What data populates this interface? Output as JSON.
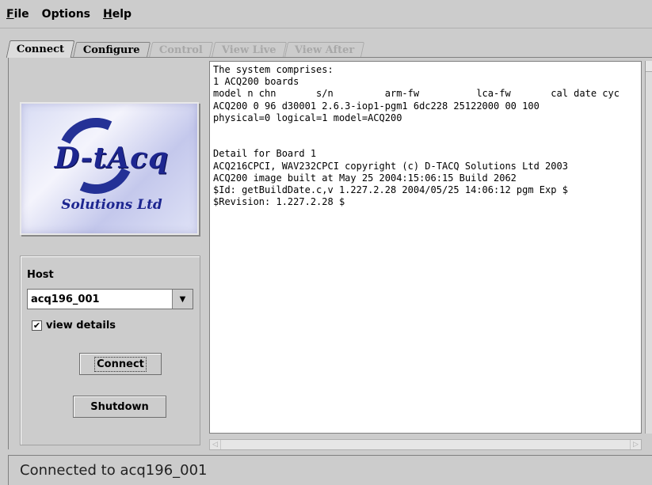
{
  "menu": {
    "file": {
      "mnemonic": "F",
      "rest": "ile"
    },
    "options": {
      "mnemonic": "",
      "rest": "Options"
    },
    "help": {
      "mnemonic": "H",
      "rest": "elp"
    }
  },
  "tabs": [
    {
      "label": "Connect",
      "state": "active"
    },
    {
      "label": "Configure",
      "state": "enabled"
    },
    {
      "label": "Control",
      "state": "disabled"
    },
    {
      "label": "View Live",
      "state": "disabled"
    },
    {
      "label": "View After",
      "state": "disabled"
    }
  ],
  "logo": {
    "main": "D-tAcq",
    "sub": "Solutions Ltd"
  },
  "host": {
    "label": "Host",
    "selected": "acq196_001",
    "arrow_icon": "▼"
  },
  "view_details": {
    "label": "view details",
    "checked": true,
    "check_glyph": "✔"
  },
  "buttons": {
    "connect": "Connect",
    "shutdown": "Shutdown"
  },
  "output_text": "The system comprises:\n1 ACQ200 boards\nmodel n chn       s/n         arm-fw          lca-fw       cal date cyc\nACQ200 0 96 d30001 2.6.3-iop1-pgm1 6dc228 25122000 00 100\nphysical=0 logical=1 model=ACQ200\n\n\nDetail for Board 1\nACQ216CPCI, WAV232CPCI copyright (c) D-TACQ Solutions Ltd 2003\nACQ200 image built at May 25 2004:15:06:15 Build 2062\n$Id: getBuildDate.c,v 1.227.2.28 2004/05/25 14:06:12 pgm Exp $\n$Revision: 1.227.2.28 $",
  "status": "Connected  to acq196_001"
}
